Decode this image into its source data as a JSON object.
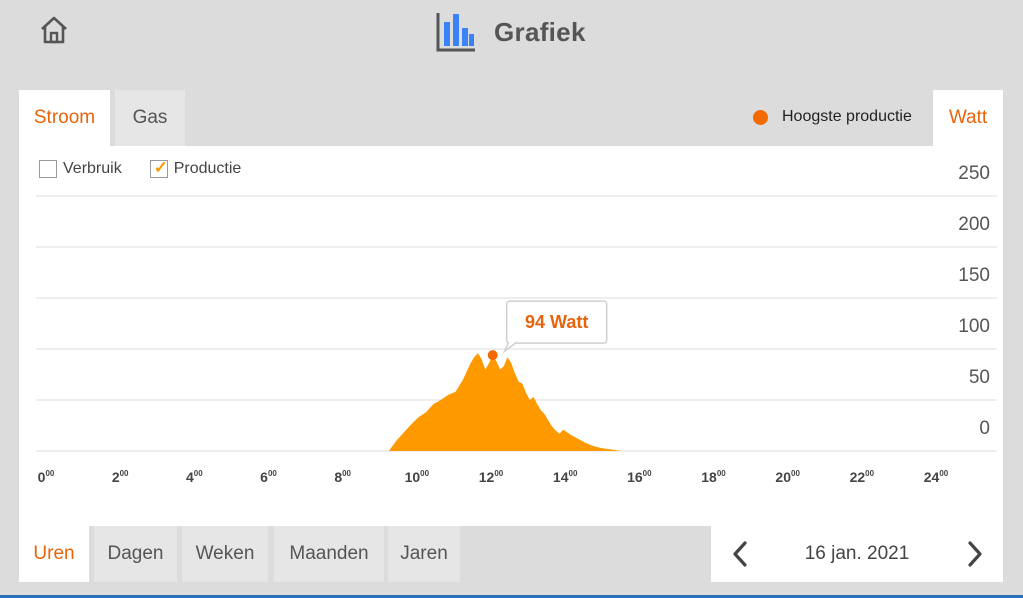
{
  "header": {
    "title": "Grafiek",
    "home_icon": "home-icon",
    "title_icon": "bar-chart-icon"
  },
  "tabs": [
    {
      "label": "Stroom",
      "active": true
    },
    {
      "label": "Gas",
      "active": false
    }
  ],
  "unit_tab": {
    "label": "Watt",
    "active": true
  },
  "legend": {
    "label": "Hoogste productie",
    "color": "#f26a00"
  },
  "checkboxes": [
    {
      "label": "Verbruik",
      "checked": false
    },
    {
      "label": "Productie",
      "checked": true
    }
  ],
  "tooltip": {
    "text": "94 Watt"
  },
  "chart_data": {
    "type": "area",
    "series": [
      {
        "color": "#ff9900",
        "x": [
          9.3,
          9.5,
          9.7,
          9.9,
          10.1,
          10.3,
          10.5,
          10.7,
          10.9,
          11.1,
          11.3,
          11.5,
          11.6,
          11.7,
          11.8,
          11.9,
          12.0,
          12.1,
          12.2,
          12.3,
          12.4,
          12.5,
          12.6,
          12.7,
          12.8,
          12.9,
          13.0,
          13.1,
          13.2,
          13.3,
          13.4,
          13.5,
          13.6,
          13.7,
          13.8,
          13.9,
          14.0,
          14.2,
          14.4,
          14.6,
          14.8,
          15.0,
          15.2,
          15.4,
          15.6
        ],
        "y": [
          0,
          10,
          18,
          26,
          33,
          38,
          46,
          50,
          55,
          58,
          70,
          86,
          92,
          96,
          90,
          80,
          86,
          94,
          88,
          80,
          83,
          92,
          86,
          76,
          68,
          66,
          57,
          50,
          53,
          46,
          40,
          36,
          30,
          24,
          20,
          17,
          21,
          16,
          12,
          8,
          5,
          3,
          2,
          1,
          0
        ]
      }
    ],
    "peak": {
      "x": 12.1,
      "y": 94
    },
    "xlim": [
      0,
      24
    ],
    "ylim": [
      0,
      250
    ],
    "x_ticks": [
      0,
      2,
      4,
      6,
      8,
      10,
      12,
      14,
      16,
      18,
      20,
      22,
      24
    ],
    "x_tick_labels": [
      "0",
      "2",
      "4",
      "6",
      "8",
      "10",
      "12",
      "14",
      "16",
      "18",
      "20",
      "22",
      "24"
    ],
    "x_tick_superscript": "00",
    "y_ticks": [
      0,
      50,
      100,
      150,
      200,
      250
    ],
    "y_tick_labels": [
      "0",
      "50",
      "100",
      "150",
      "200",
      "250"
    ],
    "grid": true
  },
  "periods": [
    {
      "label": "Uren",
      "active": true
    },
    {
      "label": "Dagen",
      "active": false
    },
    {
      "label": "Weken",
      "active": false
    },
    {
      "label": "Maanden",
      "active": false
    },
    {
      "label": "Jaren",
      "active": false
    }
  ],
  "date_nav": {
    "date": "16 jan. 2021",
    "prev_icon": "chevron-left-icon",
    "next_icon": "chevron-right-icon"
  }
}
